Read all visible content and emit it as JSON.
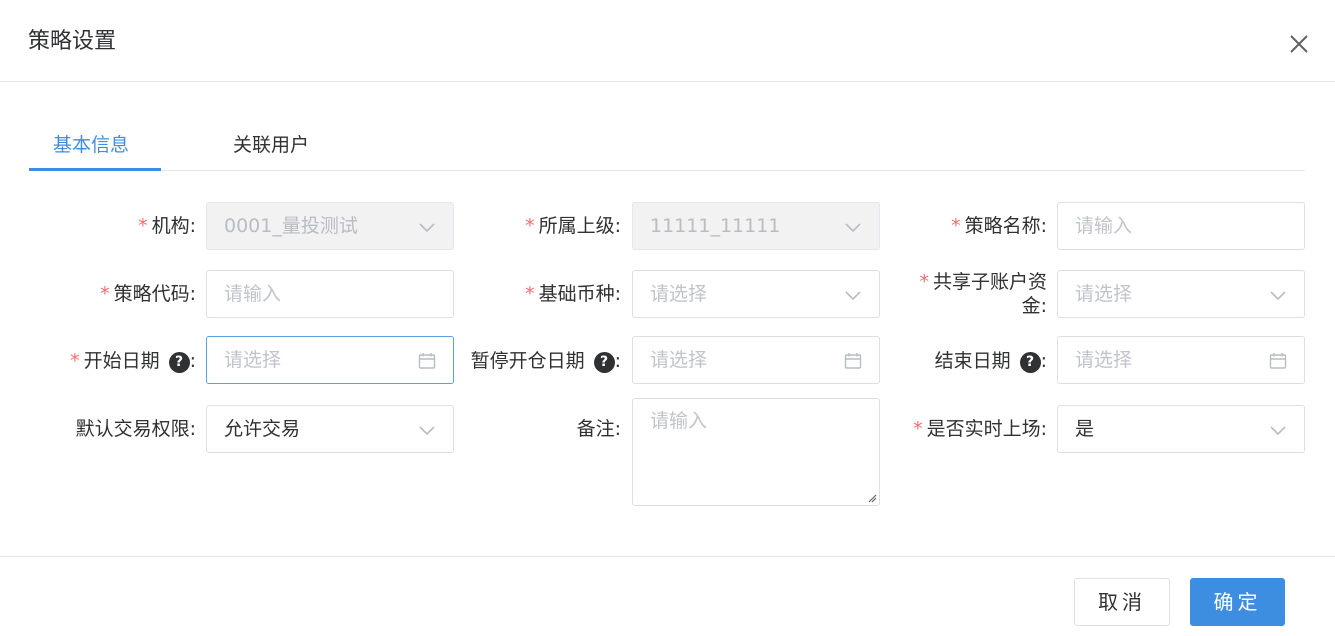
{
  "dialog": {
    "title": "策略设置"
  },
  "tabs": [
    {
      "label": "基本信息",
      "active": true
    },
    {
      "label": "关联用户",
      "active": false
    }
  ],
  "form": {
    "org": {
      "label": "机构",
      "required": true,
      "value": "0001_量投测试",
      "disabled": true,
      "icon": "chevron-down-icon"
    },
    "parent": {
      "label": "所属上级",
      "required": true,
      "value": "11111_11111",
      "disabled": true,
      "icon": "chevron-down-icon"
    },
    "strategy_name": {
      "label": "策略名称",
      "required": true,
      "placeholder": "请输入"
    },
    "strategy_code": {
      "label": "策略代码",
      "required": true,
      "placeholder": "请输入"
    },
    "base_currency": {
      "label": "基础币种",
      "required": true,
      "placeholder": "请选择",
      "icon": "chevron-down-icon"
    },
    "shared_funds": {
      "label_line1": "共享子账户资",
      "label_line2": "金",
      "required": true,
      "placeholder": "请选择",
      "icon": "chevron-down-icon"
    },
    "start_date": {
      "label": "开始日期",
      "required": true,
      "help": "?",
      "placeholder": "请选择",
      "focused": true,
      "icon": "calendar-icon"
    },
    "pause_date": {
      "label": "暂停开仓日期",
      "required": false,
      "help": "?",
      "placeholder": "请选择",
      "icon": "calendar-icon"
    },
    "end_date": {
      "label": "结束日期",
      "required": false,
      "help": "?",
      "placeholder": "请选择",
      "icon": "calendar-icon"
    },
    "trade_permission": {
      "label": "默认交易权限",
      "required": false,
      "value": "允许交易",
      "icon": "chevron-down-icon"
    },
    "remark": {
      "label": "备注",
      "required": false,
      "placeholder": "请输入"
    },
    "realtime": {
      "label": "是否实时上场",
      "required": true,
      "value": "是",
      "icon": "chevron-down-icon"
    }
  },
  "label_colon": ":",
  "required_mark": "*",
  "footer": {
    "cancel_label": "取消",
    "ok_label": "确定"
  },
  "colors": {
    "primary": "#3d8ee0",
    "required": "#f56c6c",
    "placeholder": "#c0c4cc",
    "border": "#dcdfe6"
  }
}
